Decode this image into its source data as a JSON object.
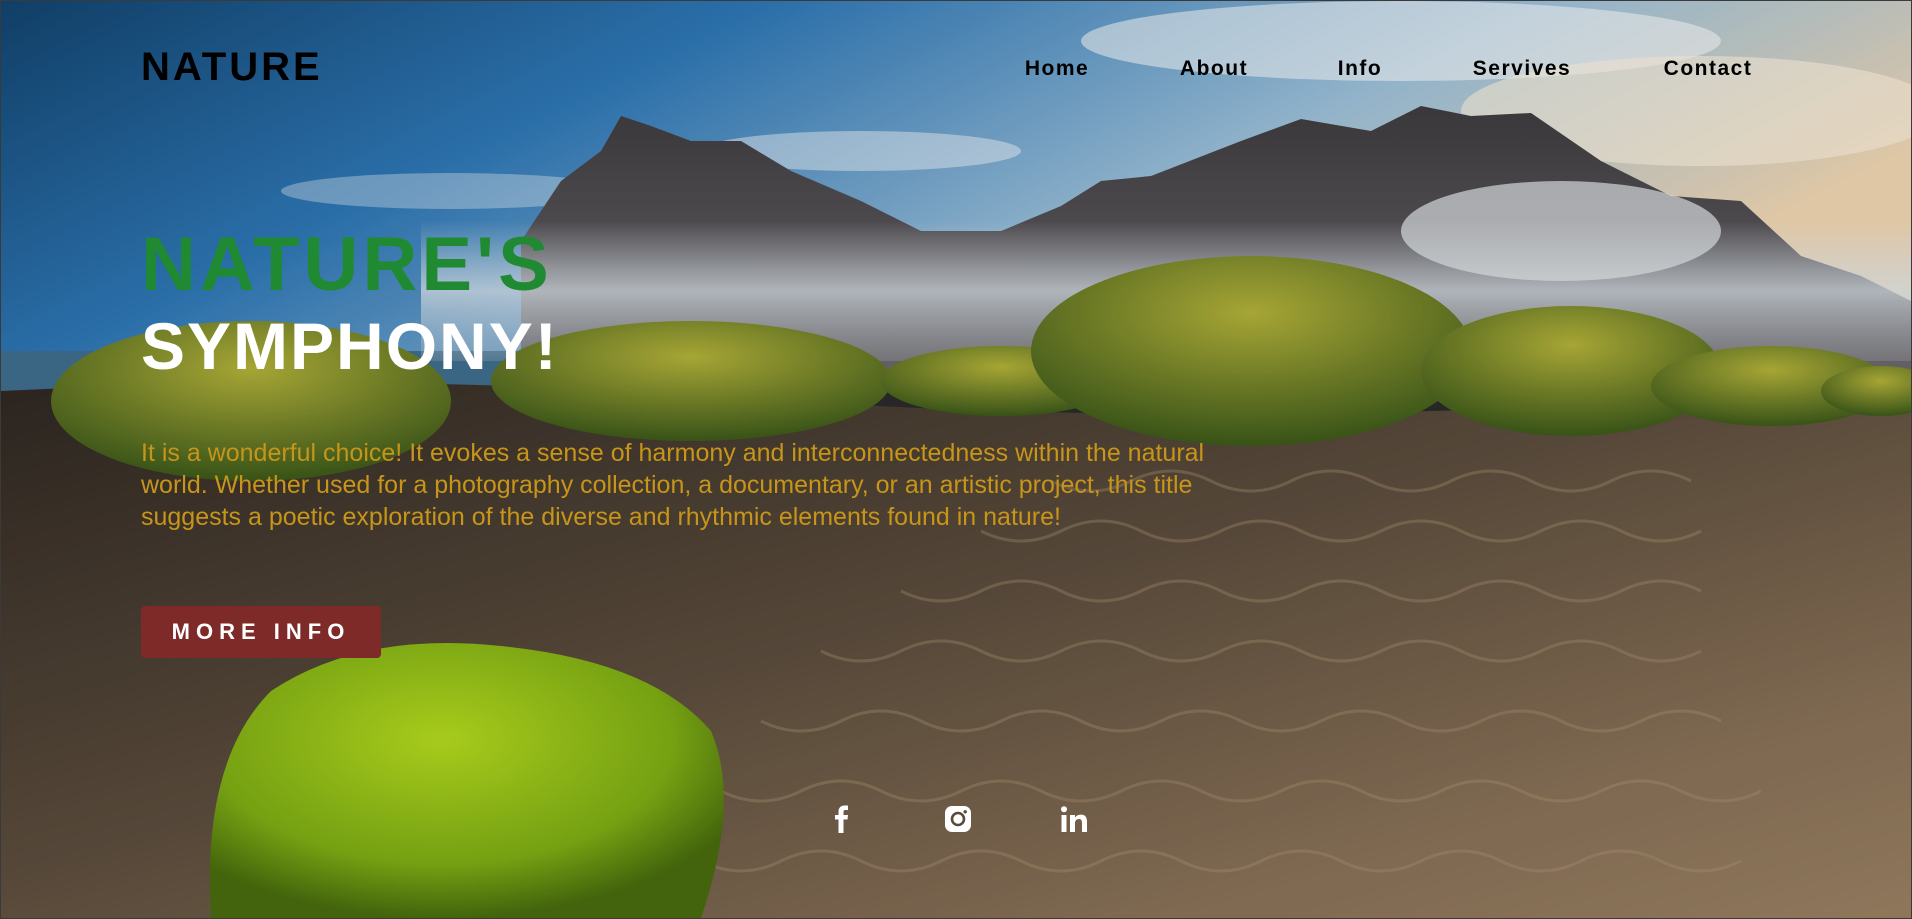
{
  "header": {
    "logo": "NATURE",
    "nav": [
      "Home",
      "About",
      "Info",
      "Servives",
      "Contact"
    ]
  },
  "hero": {
    "title_line1": "NATURE'S",
    "title_line2": "SYMPHONY!",
    "description": "It is a wonderful choice! It evokes a sense of harmony and interconnectedness within the natural world. Whether used for a photography collection, a documentary, or an artistic project, this title suggests a poetic exploration of the diverse and rhythmic elements found in nature!",
    "button_label": "MORE INFO"
  },
  "social": [
    "facebook-icon",
    "instagram-icon",
    "linkedin-icon"
  ],
  "colors": {
    "title_accent": "#1f8a32",
    "description_text": "#c69519",
    "button_bg": "#7e2a29",
    "button_text": "#ffffff"
  }
}
